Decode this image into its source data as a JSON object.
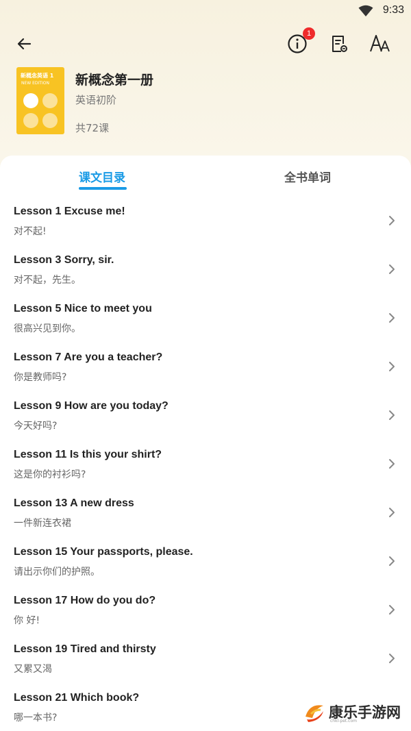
{
  "status_bar": {
    "time": "9:33"
  },
  "header": {
    "notification_badge": "1"
  },
  "book": {
    "title": "新概念第一册",
    "level": "英语初阶",
    "lesson_count": "共72课",
    "cover_title": "新概念英语 1",
    "cover_subtitle": "NEW EDITION"
  },
  "tabs": [
    {
      "label": "课文目录",
      "active": true
    },
    {
      "label": "全书单词",
      "active": false
    }
  ],
  "lessons": [
    {
      "title": "Lesson 1 Excuse me!",
      "subtitle": "对不起!"
    },
    {
      "title": "Lesson 3 Sorry, sir.",
      "subtitle": "对不起，先生。"
    },
    {
      "title": "Lesson 5 Nice to meet you",
      "subtitle": "很高兴见到你。"
    },
    {
      "title": "Lesson 7 Are you a teacher?",
      "subtitle": "你是教师吗?"
    },
    {
      "title": "Lesson 9 How are you today?",
      "subtitle": "今天好吗?"
    },
    {
      "title": "Lesson 11 Is this your shirt?",
      "subtitle": "这是你的衬衫吗?"
    },
    {
      "title": "Lesson 13 A new dress",
      "subtitle": "一件新连衣裙"
    },
    {
      "title": "Lesson 15 Your passports, please.",
      "subtitle": "请出示你们的护照。"
    },
    {
      "title": "Lesson 17 How do you do?",
      "subtitle": "你 好!"
    },
    {
      "title": "Lesson 19 Tired and thirsty",
      "subtitle": "又累又渴"
    },
    {
      "title": "Lesson 21 Which book?",
      "subtitle": "哪一本书?"
    }
  ],
  "watermark": {
    "text": "康乐手游网",
    "url_text": "chkl-pet.com"
  },
  "colors": {
    "accent": "#1a9be6",
    "badge": "#ef2b2b",
    "cover": "#f8c323"
  }
}
